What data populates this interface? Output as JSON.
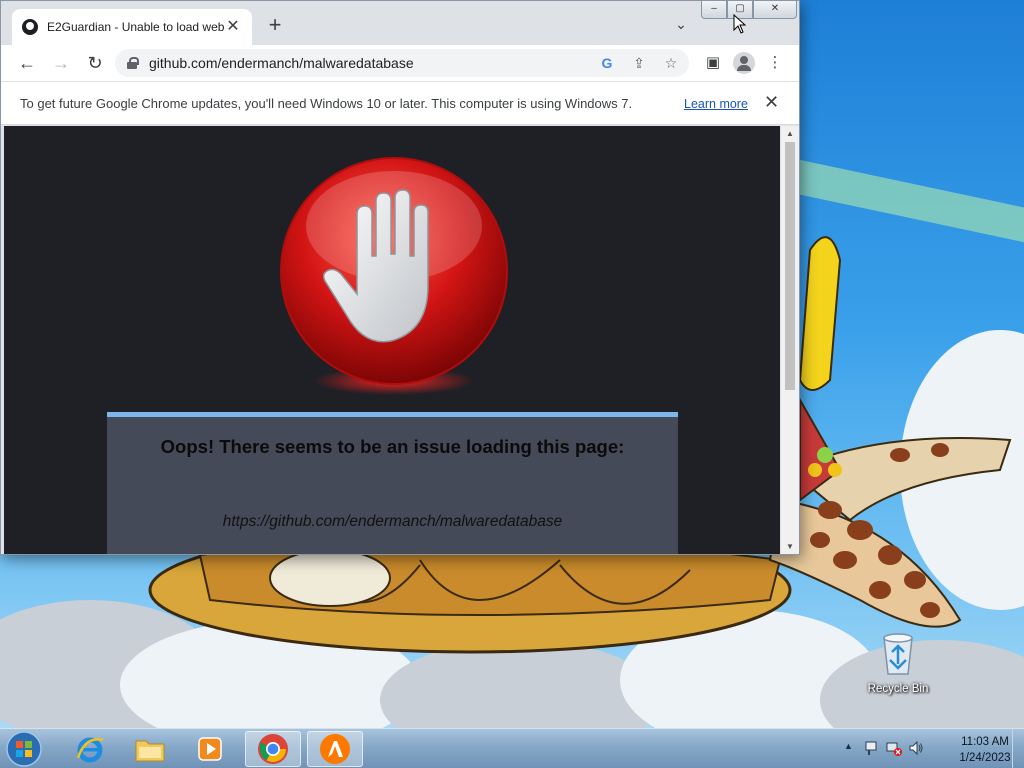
{
  "browser": {
    "tab_title": "E2Guardian - Unable to load web",
    "new_tab_symbol": "+",
    "tab_close_symbol": "✕",
    "url": "github.com/endermanch/malwaredatabase",
    "back_symbol": "←",
    "forward_symbol": "→",
    "reload_symbol": "↻",
    "menu_symbol": "⋮",
    "window_buttons": {
      "minimize": "–",
      "maximize": "▢",
      "close": "✕"
    },
    "omnibox_icons": [
      "google-icon",
      "share-icon",
      "bookmark-star-icon"
    ],
    "toolbar_icons": [
      "side-panel-icon",
      "profile-icon",
      "menu-icon"
    ]
  },
  "infobar": {
    "message": "To get future Google Chrome updates, you'll need Windows 10 or later. This computer is using Windows 7.",
    "learn_more": "Learn more",
    "close_symbol": "✕"
  },
  "blockpage": {
    "heading": "Oops! There seems to be an issue loading this page:",
    "blocked_url": "https://github.com/endermanch/malwaredatabase",
    "icon": "stop-hand-icon",
    "colors": {
      "background": "#1f2025",
      "panel": "#454a59",
      "panel_accent": "#7cb6ea",
      "stop_red": "#d01616"
    }
  },
  "desktop": {
    "icons": [
      {
        "label": "Recycle Bin",
        "icon": "recycle-bin-icon"
      }
    ]
  },
  "taskbar": {
    "pinned": [
      {
        "name": "internet-explorer",
        "icon": "internet-explorer-icon",
        "active": false
      },
      {
        "name": "file-explorer",
        "icon": "folder-icon",
        "active": false
      },
      {
        "name": "media-player",
        "icon": "media-player-icon",
        "active": false
      },
      {
        "name": "chrome",
        "icon": "chrome-icon",
        "active": true
      },
      {
        "name": "avast",
        "icon": "avast-icon",
        "active": true
      }
    ],
    "clock": {
      "time": "11:03 AM",
      "date": "1/24/2023"
    }
  }
}
